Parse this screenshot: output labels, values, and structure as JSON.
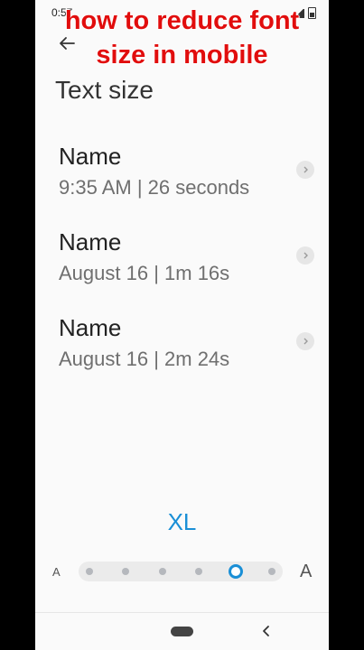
{
  "overlay": {
    "line1": "how to reduce font",
    "line2": "size in mobile"
  },
  "status_bar": {
    "time": "0:57"
  },
  "header": {
    "back_icon": "arrow-left-icon",
    "title": "Text size"
  },
  "entries": [
    {
      "name": "Name",
      "detail": "9:35 AM | 26 seconds"
    },
    {
      "name": "Name",
      "detail": "August 16 | 1m 16s"
    },
    {
      "name": "Name",
      "detail": "August 16 | 2m 24s"
    }
  ],
  "size_control": {
    "current_label": "XL",
    "small_glyph": "A",
    "large_glyph": "A",
    "levels": 6,
    "selected_index": 4,
    "accent_color": "#1a8fd6"
  },
  "nav_bar": {
    "home_icon": "home-pill-icon",
    "back_icon": "chevron-left-icon"
  }
}
